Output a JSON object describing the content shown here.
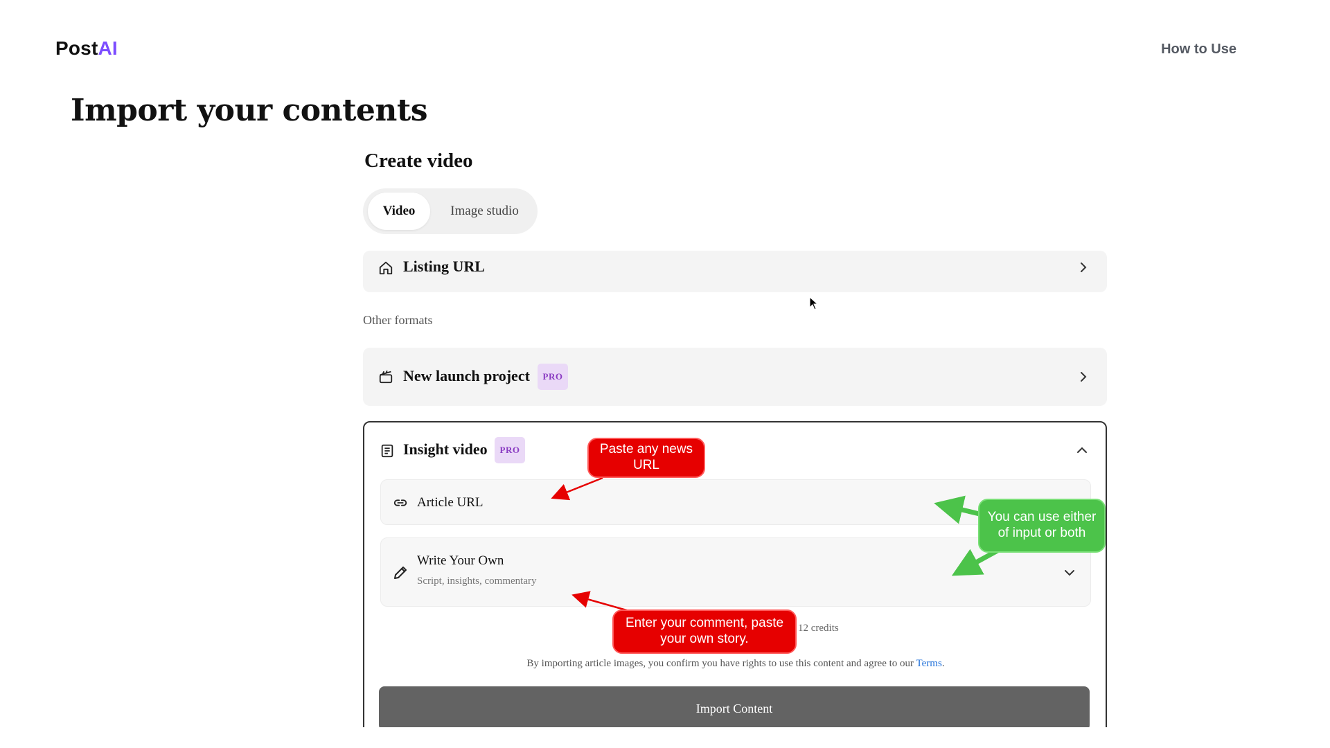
{
  "header": {
    "brand_prefix": "Post",
    "brand_suffix": "AI",
    "how_to_use": "How to Use"
  },
  "page_title": "Import your contents",
  "panel": {
    "title": "Create video",
    "tabs": [
      {
        "label": "Video",
        "active": true
      },
      {
        "label": "Image studio",
        "active": false
      }
    ],
    "listing": {
      "label": "Listing URL",
      "icon": "home-icon"
    },
    "other_formats_label": "Other formats",
    "new_launch": {
      "label": "New launch project",
      "badge": "PRO",
      "icon": "clapperboard-icon"
    },
    "insight": {
      "label": "Insight video",
      "badge": "PRO",
      "icon": "newspaper-icon",
      "article_url": {
        "label": "Article URL",
        "icon": "link-icon"
      },
      "write_own": {
        "label": "Write Your Own",
        "hint": "Script, insights, commentary",
        "icon": "pencil-icon"
      },
      "credits": "12 credits",
      "terms_text": "By importing article images, you confirm you have rights to use this content and agree to our ",
      "terms_link": "Terms",
      "terms_end": ".",
      "import_button": "Import Content"
    }
  },
  "annotations": {
    "news_url": "Paste any news URL",
    "either_input": "You can use either of input or both",
    "comment": "Enter your comment, paste your own story."
  },
  "colors": {
    "brand_accent": "#7c4dff",
    "pro_badge_bg": "#ead9f7",
    "pro_badge_text": "#8a3cc2",
    "annotation_red": "#e60000",
    "annotation_green": "#4cc34a",
    "link": "#1e6fd9",
    "import_button": "#636363"
  }
}
